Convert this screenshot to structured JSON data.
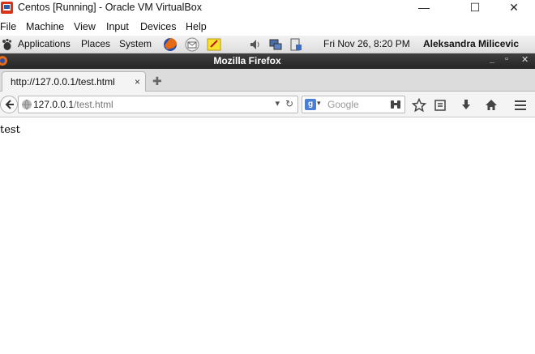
{
  "host_window": {
    "title": "Centos [Running] - Oracle VM VirtualBox",
    "controls": {
      "minimize": "—",
      "maximize": "☐",
      "close": "✕"
    }
  },
  "vbox_menu": [
    "File",
    "Machine",
    "View",
    "Input",
    "Devices",
    "Help"
  ],
  "gnome_panel": {
    "applications": "Applications",
    "places": "Places",
    "system": "System",
    "datetime": "Fri Nov 26,  8:20 PM",
    "user": "Aleksandra Milicevic"
  },
  "firefox": {
    "window_title": "Mozilla Firefox",
    "title_controls": {
      "minimize": "_",
      "maximize": "▫",
      "close": "✕"
    },
    "tab": {
      "label": "http://127.0.0.1/test.html",
      "close": "×"
    },
    "new_tab": "✚",
    "url": {
      "host": "127.0.0.1",
      "path": "/test.html"
    },
    "search": {
      "engine": "g",
      "placeholder": "Google"
    },
    "page_text": "test"
  },
  "colors": {
    "titlebar_dark": "#2e2e2e",
    "panel_bg": "#e9e9e9",
    "tab_bg": "#f4f4f4"
  }
}
